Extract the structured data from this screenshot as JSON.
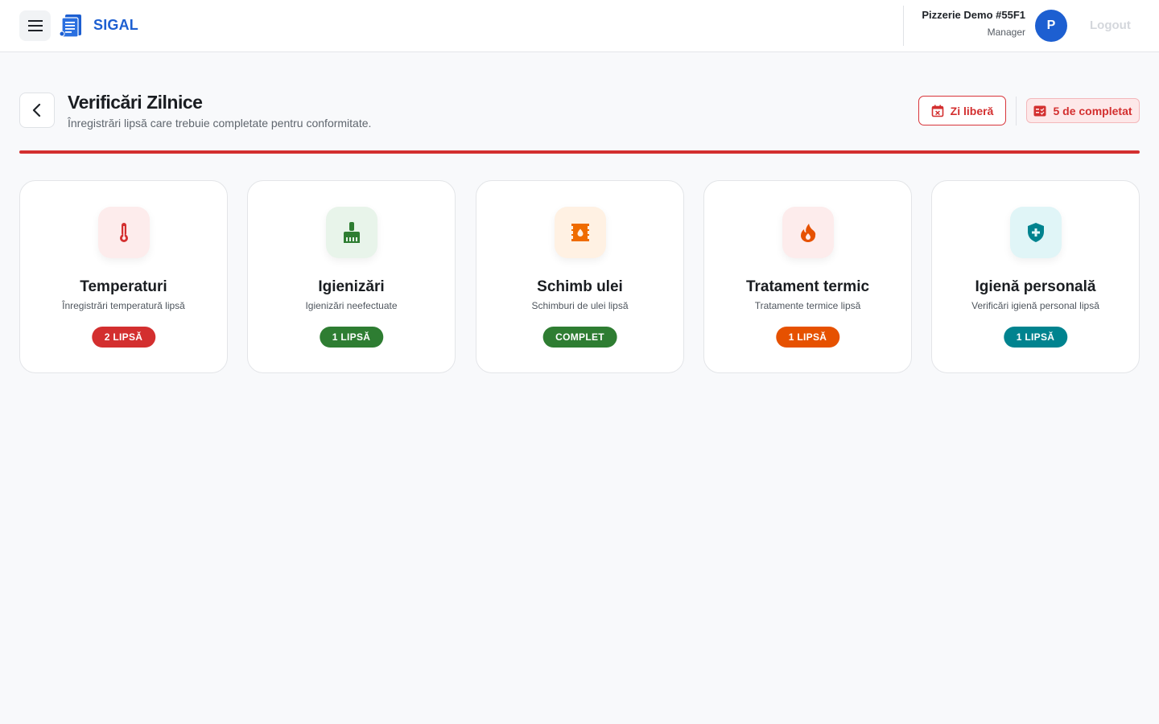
{
  "app": {
    "brand": "SIGAL",
    "logout_label": "Logout",
    "user": {
      "name": "Pizzerie Demo #55F1",
      "role": "Manager",
      "avatar_initial": "P"
    }
  },
  "page": {
    "title": "Verificări Zilnice",
    "subtitle": "Înregistrări lipsă care trebuie completate pentru conformitate.",
    "free_day_label": "Zi liberă",
    "pending_count_label": "5 de completat"
  },
  "cards": [
    {
      "title": "Temperaturi",
      "subtitle": "Înregistrări temperatură lipsă",
      "status": "2 LIPSĂ",
      "icon": "thermometer-icon",
      "color": "#d32f2f",
      "tint": "#fdecec"
    },
    {
      "title": "Igienizări",
      "subtitle": "Igienizări neefectuate",
      "status": "1 LIPSĂ",
      "icon": "cleaning-brush-icon",
      "color": "#2e7d32",
      "tint": "#e8f4ea"
    },
    {
      "title": "Schimb ulei",
      "subtitle": "Schimburi de ulei lipsă",
      "status": "COMPLET",
      "icon": "oil-barrel-icon",
      "color": "#ef6c00",
      "tint": "#fff1e3"
    },
    {
      "title": "Tratament termic",
      "subtitle": "Tratamente termice lipsă",
      "status": "1 LIPSĂ",
      "icon": "flame-icon",
      "color": "#e65100",
      "tint": "#fdecec"
    },
    {
      "title": "Igienă personală",
      "subtitle": "Verificări igienă personal lipsă",
      "status": "1 LIPSĂ",
      "icon": "health-shield-icon",
      "color": "#00838f",
      "tint": "#e0f5f7"
    }
  ],
  "colors": {
    "brand_blue": "#1d5fd1",
    "alert_red": "#d32f2f",
    "complete_green": "#2e7d32"
  }
}
